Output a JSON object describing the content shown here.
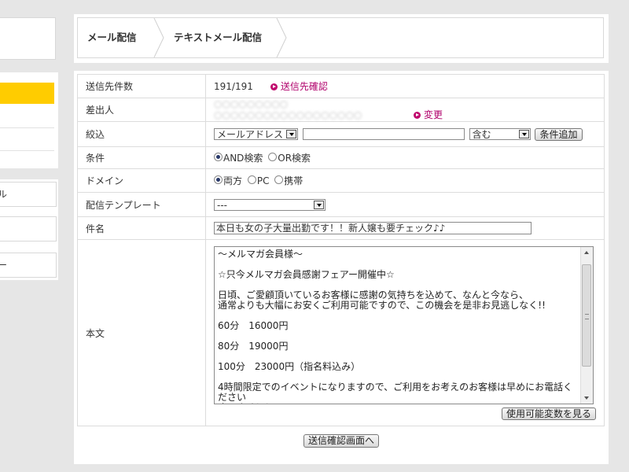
{
  "sidebar": {
    "items": [
      {
        "label": "ル"
      },
      {
        "label": ""
      },
      {
        "label": "ー"
      }
    ]
  },
  "breadcrumb": {
    "items": [
      {
        "label": "メール配信"
      },
      {
        "label": "テキストメール配信"
      }
    ]
  },
  "form": {
    "recipients": {
      "label": "送信先件数",
      "value": "191/191",
      "link": "送信先確認"
    },
    "sender": {
      "label": "差出人",
      "value_blurred": "○○○○○○○○○ ○○○○○○○○○○○○○○○○○○",
      "link": "変更"
    },
    "filter": {
      "label": "絞込",
      "field_select": "メールアドレス",
      "text_value": "",
      "match_select": "含む",
      "add_button": "条件追加"
    },
    "condition": {
      "label": "条件",
      "options": [
        {
          "label": "AND検索",
          "selected": true
        },
        {
          "label": "OR検索",
          "selected": false
        }
      ]
    },
    "domain": {
      "label": "ドメイン",
      "options": [
        {
          "label": "両方",
          "selected": true
        },
        {
          "label": "PC",
          "selected": false
        },
        {
          "label": "携帯",
          "selected": false
        }
      ]
    },
    "template": {
      "label": "配信テンプレート",
      "selected": "---"
    },
    "subject": {
      "label": "件名",
      "value": "本日も女の子大量出勤です！！新人嬢も要チェック♪♪"
    },
    "body": {
      "label": "本文",
      "value": "～メルマガ会員様～\n\n☆只今メルマガ会員感謝フェアー開催中☆\n\n日頃、ご愛顧頂いているお客様に感謝の気持ちを込めて、なんと今なら、\n通常よりも大幅にお安くご利用可能ですので、この機会を是非お見逃しなく!!\n\n60分　16000円\n\n80分　19000円\n\n100分　23000円（指名料込み）\n\n4時間限定でのイベントになりますので、ご利用をお考えのお客様は早めにお電話ください\nさいませ！！",
      "vars_button": "使用可能変数を見る"
    },
    "submit_button": "送信確認画面へ"
  }
}
